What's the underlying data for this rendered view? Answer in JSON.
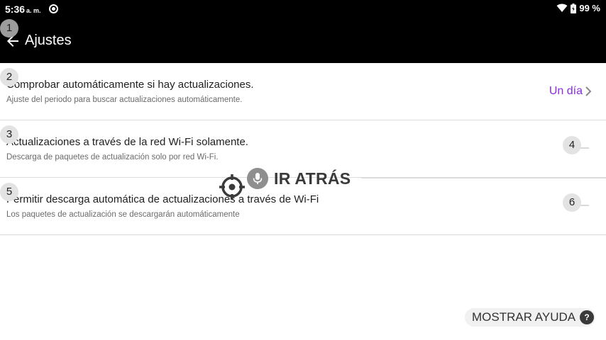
{
  "status_bar": {
    "time": "5:36",
    "ampm": "a. m.",
    "battery": "99 %",
    "icons": [
      "screen-record-icon",
      "wifi-icon",
      "battery-icon"
    ]
  },
  "app_bar": {
    "title": "Ajustes",
    "back_icon": "arrow-left-icon"
  },
  "settings": [
    {
      "title": "Comprobar automáticamente si hay actualizaciones.",
      "subtitle": "Ajuste del periodo para buscar actualizaciones automáticamente.",
      "value": "Un día"
    },
    {
      "title": "Actualizaciones a través de la red Wi-Fi solamente.",
      "subtitle": "Descarga de paquetes de actualización solo por red Wi-Fi.",
      "toggle_on": false
    },
    {
      "title": "Permitir descarga automática de actualizaciones a través de Wi-Fi",
      "subtitle": "Los paquetes de actualización se descargarán automáticamente",
      "toggle_on": false
    }
  ],
  "badges": [
    "1",
    "2",
    "3",
    "4",
    "5",
    "6"
  ],
  "voice_overlay": {
    "text": "IR ATRÁS",
    "icons": [
      "crosshair-icon",
      "microphone-icon"
    ]
  },
  "help": {
    "label": "MOSTRAR AYUDA",
    "icon_text": "?"
  },
  "colors": {
    "accent": "#8a2be2",
    "bar": "#000000"
  }
}
